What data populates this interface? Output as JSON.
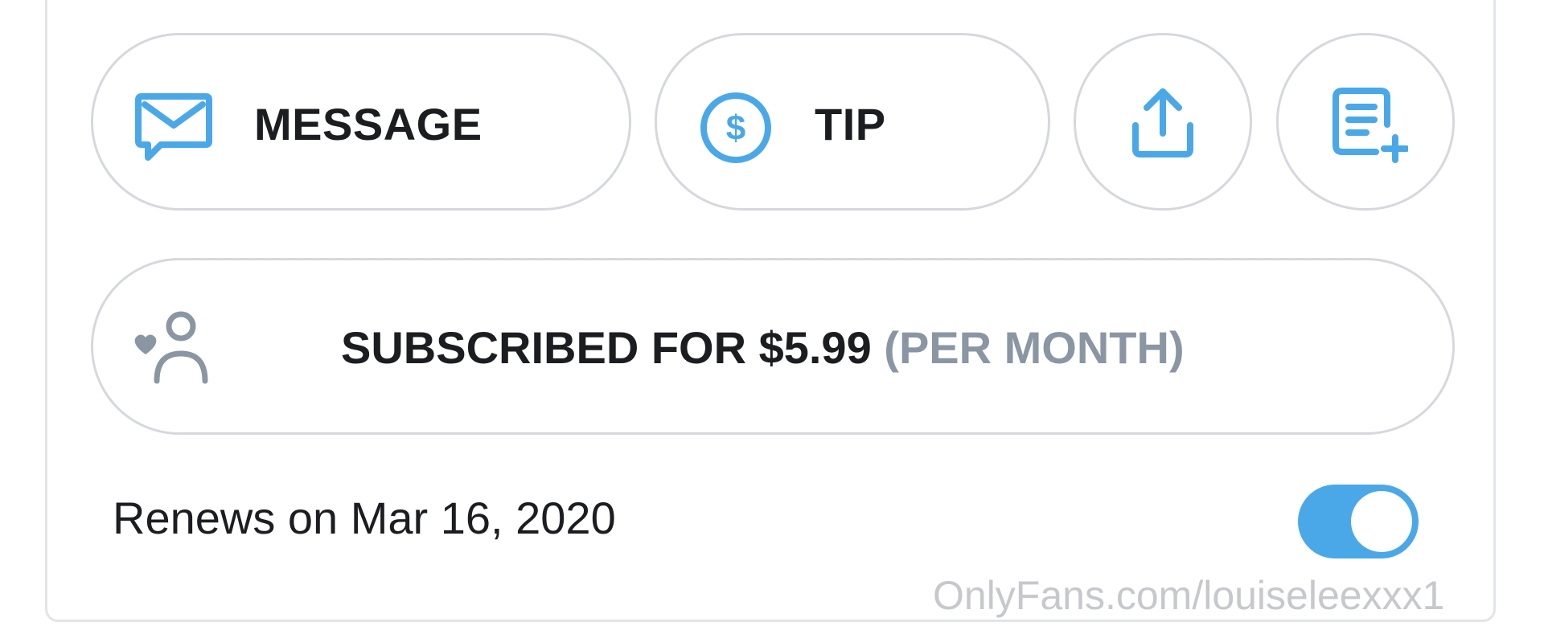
{
  "actions": {
    "message_label": "MESSAGE",
    "tip_label": "TIP",
    "share_icon": "share-upload-icon",
    "add_to_list_icon": "add-to-list-icon"
  },
  "subscription": {
    "status_text": "SUBSCRIBED FOR $5.99",
    "period_text": "(PER MONTH)",
    "icon": "user-heart-icon"
  },
  "renewal": {
    "text": "Renews on Mar 16, 2020",
    "auto_renew_enabled": true
  },
  "watermark": {
    "text": "OnlyFans.com/louiseleexxx1"
  },
  "colors": {
    "accent": "#4aa8e8",
    "text_primary": "#1c1d21",
    "text_muted": "#8a96a3",
    "border": "#d5d8dd"
  }
}
